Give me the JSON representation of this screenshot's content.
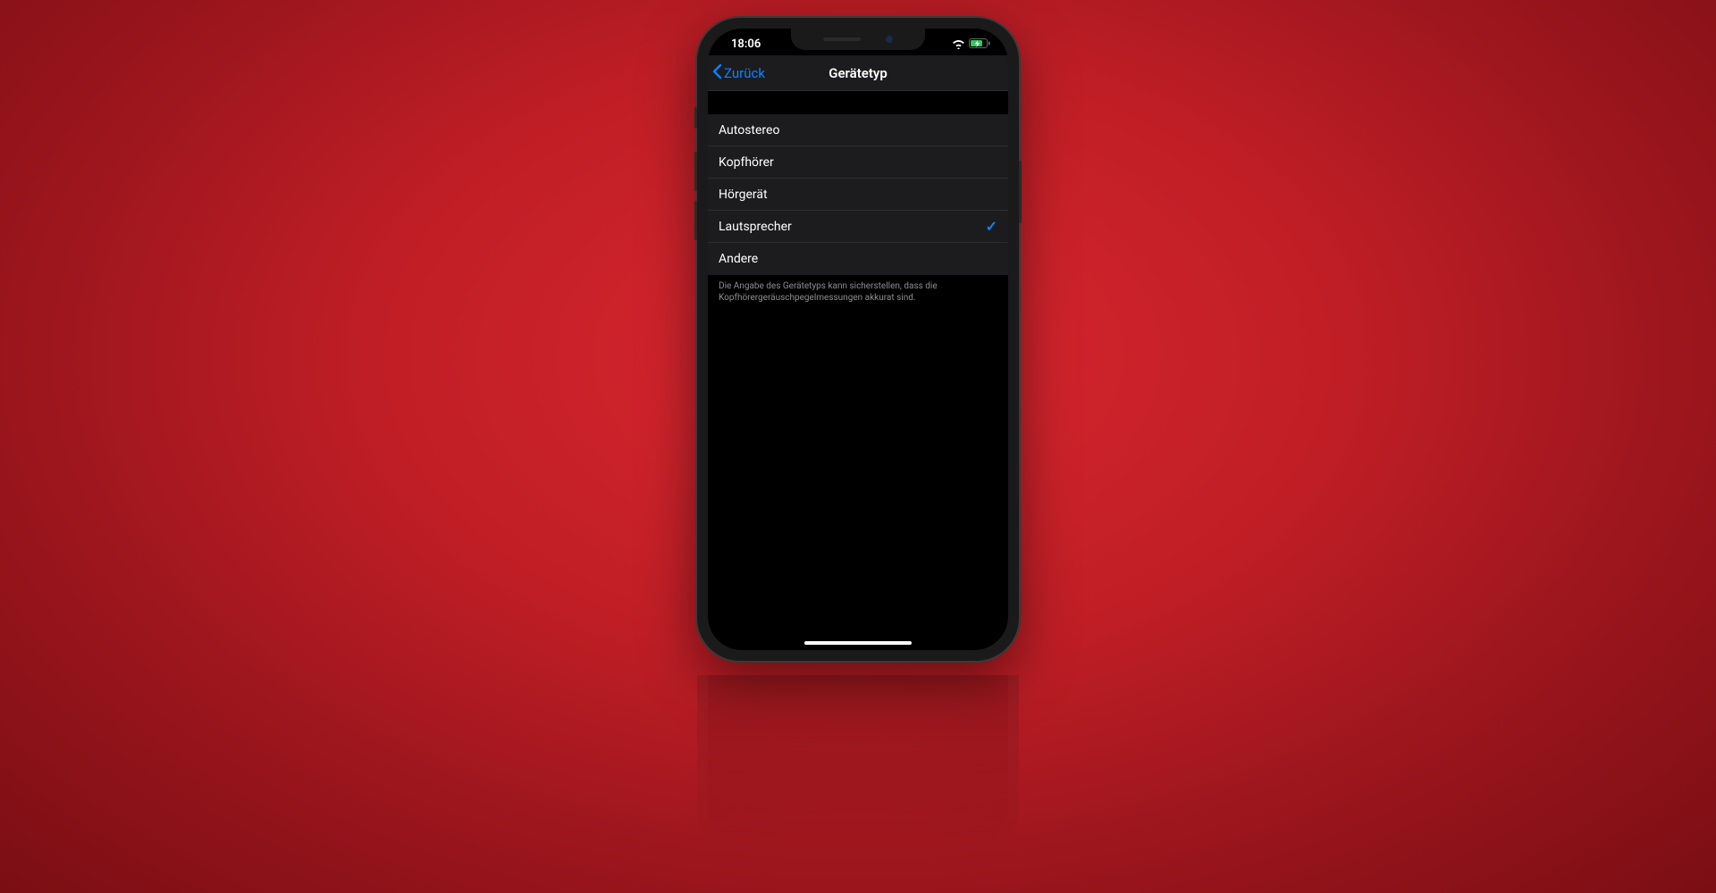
{
  "status": {
    "time": "18:06"
  },
  "nav": {
    "back_label": "Zurück",
    "title": "Gerätetyp"
  },
  "options": [
    {
      "label": "Autostereo",
      "selected": false
    },
    {
      "label": "Kopfhörer",
      "selected": false
    },
    {
      "label": "Hörgerät",
      "selected": false
    },
    {
      "label": "Lautsprecher",
      "selected": true
    },
    {
      "label": "Andere",
      "selected": false
    }
  ],
  "footer_text": "Die Angabe des Gerätetyps kann sicherstellen, dass die Kopfhörergeräuschpegelmessungen akkurat sind.",
  "colors": {
    "accent": "#0a84ff",
    "background": "#000000",
    "row_bg": "#1c1c1e",
    "secondary_text": "#8e8e93"
  }
}
